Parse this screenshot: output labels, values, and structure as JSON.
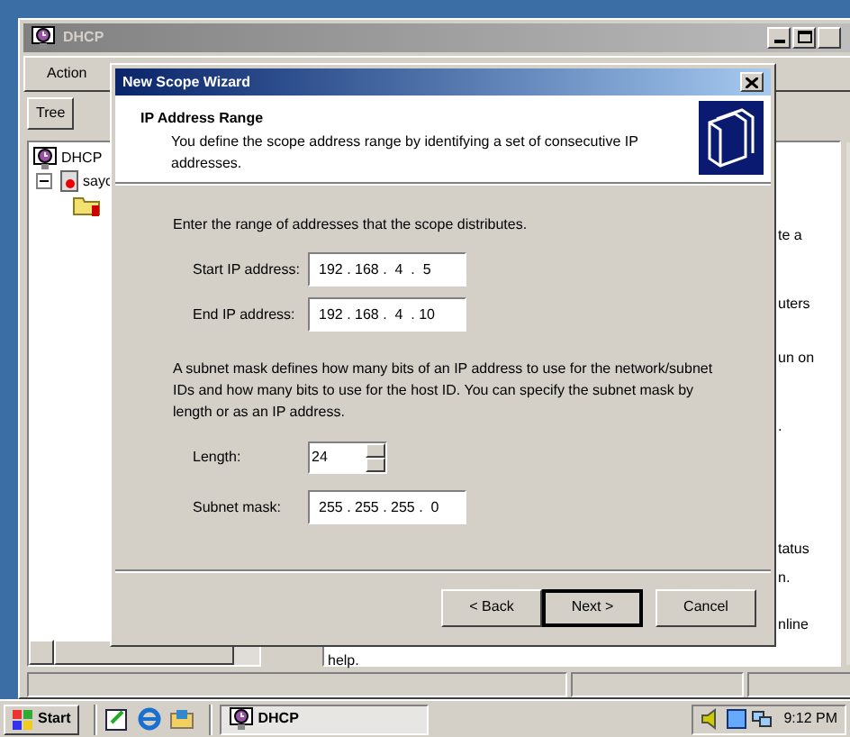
{
  "dhcp_window": {
    "title": "DHCP",
    "menu": [
      "Action"
    ],
    "tabs": [
      {
        "label": "Tree",
        "selected": true
      }
    ],
    "tree": [
      {
        "label": "DHCP",
        "children": [
          {
            "label": "sayc",
            "expanded": true
          }
        ]
      }
    ],
    "detail_fragments": [
      "te a",
      "uters",
      "un on",
      ".",
      "tatus",
      "n.",
      "nline",
      "help."
    ]
  },
  "wizard": {
    "title": "New Scope Wizard",
    "heading": "IP Address Range",
    "subheading": "You define the scope address range by identifying a set of consecutive IP addresses.",
    "intro": "Enter the range of addresses that the scope distributes.",
    "fields": [
      {
        "label": "Start IP address:",
        "value": "192 . 168 .  4  .  5"
      },
      {
        "label": "End IP address:",
        "value": "192 . 168 .  4  . 10"
      }
    ],
    "subnet_note": "A subnet mask defines how many bits of an IP address to use for the network/subnet IDs and how many bits to use for the host ID. You can specify the subnet mask by length or as an IP address.",
    "length": {
      "label": "Length:",
      "value": "24"
    },
    "subnet_mask": {
      "label": "Subnet mask:",
      "value": "255 . 255 . 255 .  0"
    },
    "buttons": [
      {
        "label": "< Back",
        "default": false
      },
      {
        "label": "Next >",
        "default": true
      },
      {
        "label": "Cancel",
        "default": false
      }
    ]
  },
  "taskbar": {
    "start": "Start",
    "tasks": [
      {
        "label": "DHCP",
        "selected": true
      }
    ],
    "clock": "9:12 PM"
  }
}
